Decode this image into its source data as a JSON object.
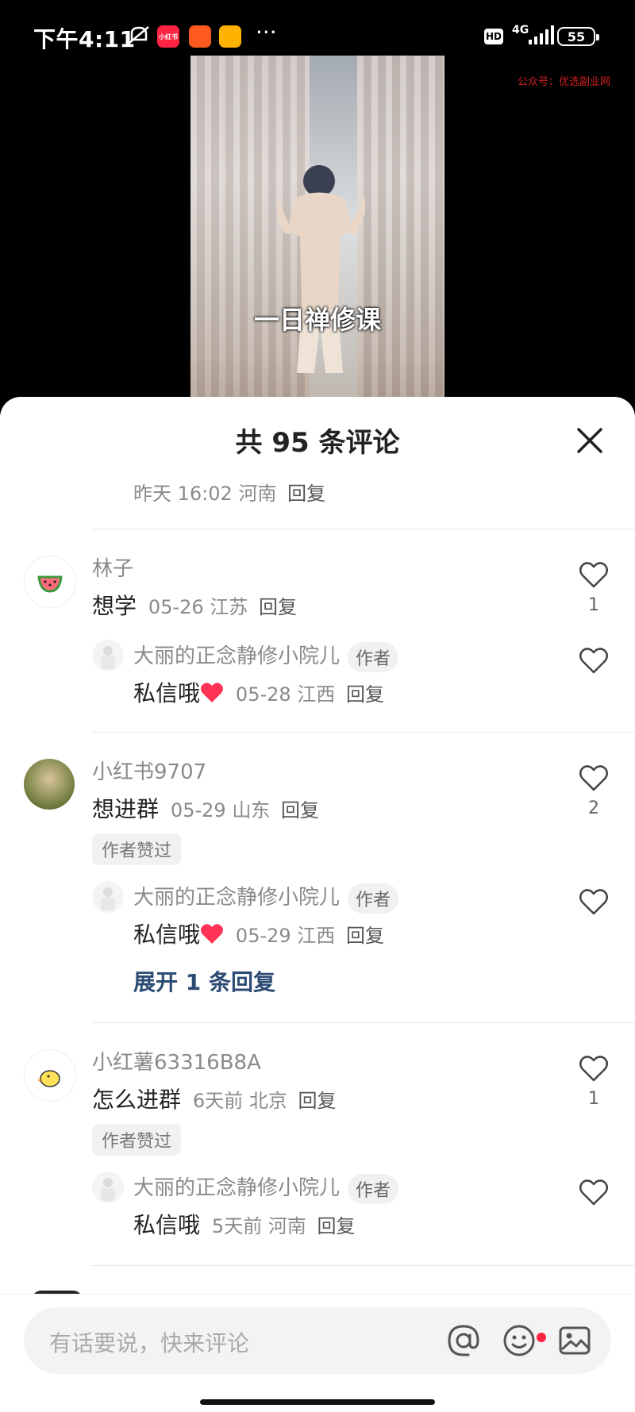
{
  "status_bar": {
    "time": "下午4:11",
    "app_icon_1_text": "小红书",
    "network": "4G",
    "hd": "HD",
    "battery": "55",
    "more": "···"
  },
  "watermark": "公众号：优选副业网",
  "video": {
    "caption": "一日禅修课"
  },
  "sheet": {
    "title": "共 95 条评论",
    "top_meta": {
      "time": "昨天 16:02",
      "location": "河南",
      "reply": "回复"
    }
  },
  "comments": [
    {
      "username": "林子",
      "text": "想学",
      "time": "05-26",
      "location": "江苏",
      "reply": "回复",
      "likes": "1",
      "reply_item": {
        "username": "大丽的正念静修小院儿",
        "badge": "作者",
        "text": "私信哦",
        "time": "05-28",
        "location": "江西",
        "reply": "回复"
      }
    },
    {
      "username": "小红书9707",
      "text": "想进群",
      "time": "05-29",
      "location": "山东",
      "reply": "回复",
      "likes": "2",
      "liked_tag": "作者赞过",
      "reply_item": {
        "username": "大丽的正念静修小院儿",
        "badge": "作者",
        "text": "私信哦",
        "time": "05-29",
        "location": "江西",
        "reply": "回复"
      },
      "expand": "展开 1 条回复"
    },
    {
      "username": "小红薯63316B8A",
      "text": "怎么进群",
      "time": "6天前",
      "location": "北京",
      "reply": "回复",
      "likes": "1",
      "liked_tag": "作者赞过",
      "reply_item": {
        "username": "大丽的正念静修小院儿",
        "badge": "作者",
        "text": "私信哦",
        "time": "5天前",
        "location": "河南",
        "reply": "回复"
      }
    }
  ],
  "input": {
    "placeholder": "有话要说，快来评论"
  },
  "colors": {
    "accent_red": "#ff2442",
    "expand_blue": "#2c4b73"
  },
  "icons": [
    "close-icon",
    "heart-outline-icon",
    "at-icon",
    "emoji-icon",
    "image-icon",
    "heart-emoji-icon"
  ]
}
